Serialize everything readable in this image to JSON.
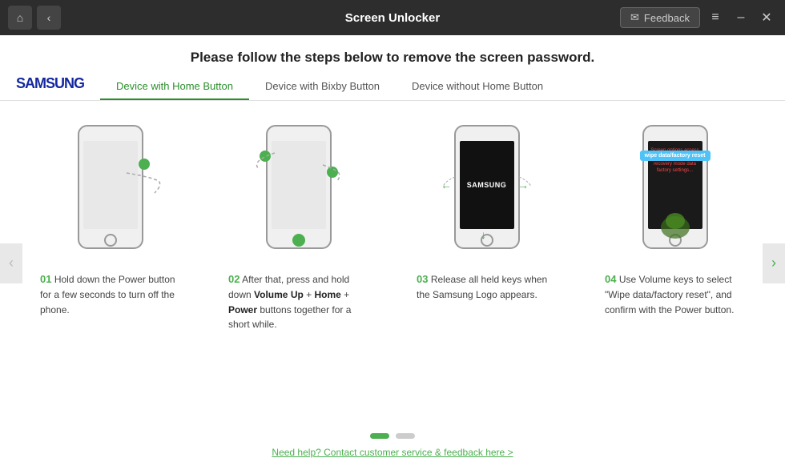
{
  "titlebar": {
    "title": "Screen Unlocker",
    "home_icon": "⌂",
    "back_icon": "‹",
    "feedback_label": "Feedback",
    "menu_icon": "≡",
    "minimize_icon": "–",
    "close_icon": "✕"
  },
  "headline": "Please follow the steps below to remove the screen password.",
  "samsung_logo": "SAMSUNG",
  "tabs": [
    {
      "id": "home-button",
      "label": "Device with Home Button",
      "active": true
    },
    {
      "id": "bixby-button",
      "label": "Device with Bixby Button",
      "active": false
    },
    {
      "id": "no-home",
      "label": "Device without Home Button",
      "active": false
    }
  ],
  "steps": [
    {
      "number": "01",
      "description": "Hold down the Power button for a few seconds to turn off the phone."
    },
    {
      "number": "02",
      "description": "After that, press and hold down Volume Up + Home + Power buttons together for a short while."
    },
    {
      "number": "03",
      "description": "Release all held keys when the Samsung Logo appears."
    },
    {
      "number": "04",
      "description": "Use Volume keys to select \"Wipe data/factory reset\", and confirm with the Power button."
    }
  ],
  "wipe_tooltip": "wipe data/factory reset",
  "pagination": {
    "dots": [
      {
        "active": true
      },
      {
        "active": false
      }
    ]
  },
  "help_link": "Need help? Contact customer service & feedback here >"
}
